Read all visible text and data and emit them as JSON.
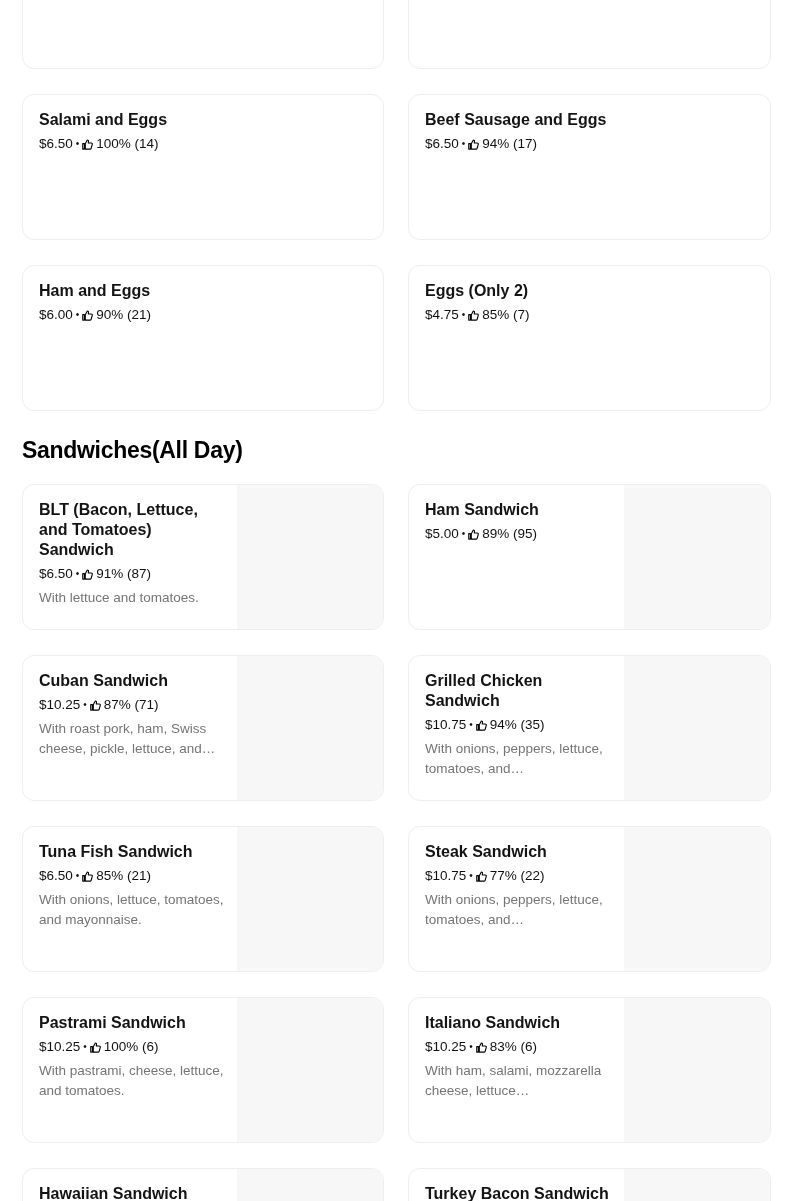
{
  "separator": "•",
  "sections": [
    {
      "items": [
        {
          "kind": "blank"
        },
        {
          "kind": "blank"
        },
        {
          "kind": "text_card",
          "title": "Salami and Eggs",
          "price": "$6.50",
          "rating": "100% (14)"
        },
        {
          "kind": "text_card",
          "title": "Beef Sausage and Eggs",
          "price": "$6.50",
          "rating": "94% (17)"
        },
        {
          "kind": "text_card",
          "title": "Ham and Eggs",
          "price": "$6.00",
          "rating": "90% (21)"
        },
        {
          "kind": "text_card",
          "title": "Eggs (Only 2)",
          "price": "$4.75",
          "rating": "85% (7)"
        }
      ]
    },
    {
      "title": "Sandwiches(All Day)",
      "items": [
        {
          "kind": "image_card",
          "title": "BLT (Bacon, Lettuce, and Tomatoes) Sandwich",
          "price": "$6.50",
          "rating": "91% (87)",
          "description": "With lettuce and tomatoes."
        },
        {
          "kind": "image_card",
          "title": "Ham Sandwich",
          "price": "$5.00",
          "rating": "89% (95)"
        },
        {
          "kind": "image_card",
          "title": "Cuban Sandwich",
          "price": "$10.25",
          "rating": "87% (71)",
          "description": "With roast pork, ham, Swiss cheese, pickle, lettuce, and…"
        },
        {
          "kind": "image_card",
          "title": "Grilled Chicken Sandwich",
          "price": "$10.75",
          "rating": "94% (35)",
          "description": "With onions, peppers, lettuce, tomatoes, and…"
        },
        {
          "kind": "image_card",
          "title": "Tuna Fish Sandwich",
          "price": "$6.50",
          "rating": "85% (21)",
          "description": "With onions, lettuce, tomatoes, and mayonnaise."
        },
        {
          "kind": "image_card",
          "title": "Steak Sandwich",
          "price": "$10.75",
          "rating": "77% (22)",
          "description": "With onions, peppers, lettuce, tomatoes, and…"
        },
        {
          "kind": "image_card",
          "title": "Pastrami Sandwich",
          "price": "$10.25",
          "rating": "100% (6)",
          "description": "With pastrami, cheese, lettuce, and tomatoes."
        },
        {
          "kind": "image_card",
          "title": "Italiano Sandwich",
          "price": "$10.25",
          "rating": "83% (6)",
          "description": "With ham, salami, mozzarella cheese, lettuce…"
        },
        {
          "kind": "image_card",
          "title": "Hawaiian Sandwich"
        },
        {
          "kind": "image_card",
          "title": "Turkey Bacon Sandwich"
        }
      ]
    }
  ]
}
